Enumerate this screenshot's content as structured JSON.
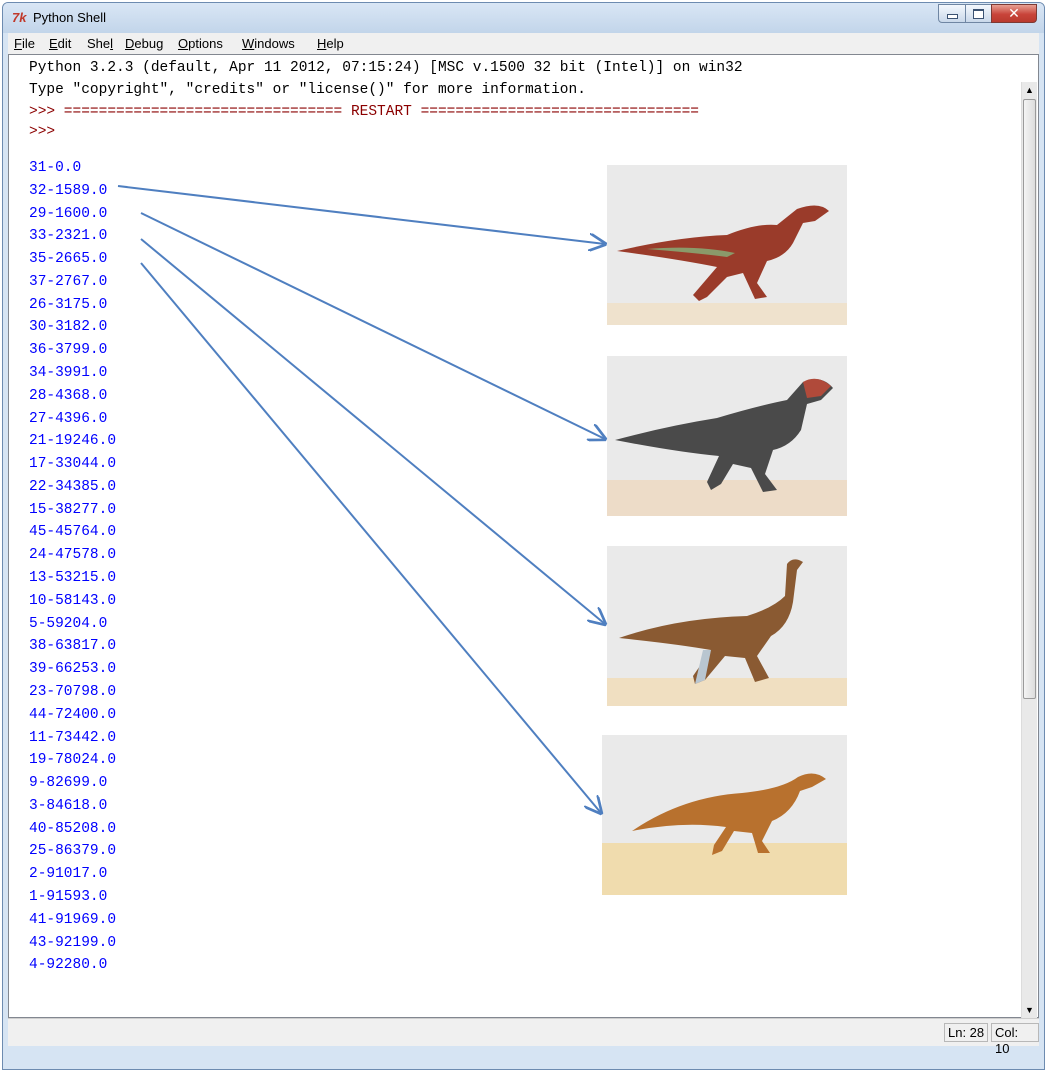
{
  "window": {
    "title": "Python Shell",
    "icon": "tk-feather-icon"
  },
  "menu": [
    {
      "label": "File",
      "accel": "F",
      "rest": "ile"
    },
    {
      "label": "Edit",
      "accel": "E",
      "rest": "dit"
    },
    {
      "label": "Shell",
      "accel": "l",
      "prefix": "She",
      "rest": ""
    },
    {
      "label": "Debug",
      "accel": "D",
      "rest": "ebug"
    },
    {
      "label": "Options",
      "accel": "O",
      "rest": "ptions"
    },
    {
      "label": "Windows",
      "accel": "W",
      "rest": "indows"
    },
    {
      "label": "Help",
      "accel": "H",
      "rest": "elp"
    }
  ],
  "shell": {
    "banner": [
      "Python 3.2.3 (default, Apr 11 2012, 07:15:24) [MSC v.1500 32 bit (Intel)] on win32",
      "Type \"copyright\", \"credits\" or \"license()\" for more information."
    ],
    "restart_line": ">>> ================================ RESTART ================================",
    "prompt": ">>>",
    "output": [
      "31-0.0",
      "32-1589.0",
      "29-1600.0",
      "33-2321.0",
      "35-2665.0",
      "37-2767.0",
      "26-3175.0",
      "30-3182.0",
      "36-3799.0",
      "34-3991.0",
      "28-4368.0",
      "27-4396.0",
      "21-19246.0",
      "17-33044.0",
      "22-34385.0",
      "15-38277.0",
      "45-45764.0",
      "24-47578.0",
      "13-53215.0",
      "10-58143.0",
      "5-59204.0",
      "38-63817.0",
      "39-66253.0",
      "23-70798.0",
      "44-72400.0",
      "11-73442.0",
      "19-78024.0",
      "9-82699.0",
      "3-84618.0",
      "40-85208.0",
      "25-86379.0",
      "2-91017.0",
      "1-91593.0",
      "41-91969.0",
      "43-92199.0",
      "4-92280.0"
    ]
  },
  "images": [
    "red-dinosaur-image",
    "dark-gray-dinosaur-image",
    "brown-ornithomimid-image",
    "orange-hypsilophodont-image"
  ],
  "status": {
    "line": "Ln: 28",
    "col": "Col: 10"
  },
  "colors": {
    "banner_text": "#000000",
    "prompt": "#8b0000",
    "output": "#0000ff",
    "arrow": "#4f7fc0"
  }
}
